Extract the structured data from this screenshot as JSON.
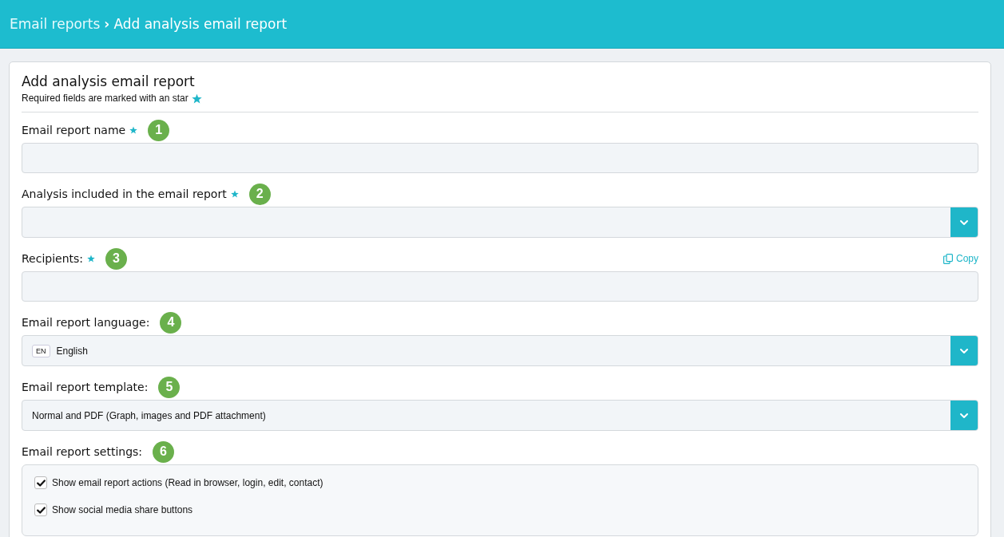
{
  "breadcrumb": {
    "parent": "Email reports",
    "separator": "›",
    "current": "Add analysis email report"
  },
  "form": {
    "title": "Add analysis email report",
    "subtitle": "Required fields are marked with an star",
    "fields": [
      {
        "kind": "text",
        "label": "Email report name",
        "required": true,
        "badge": "1"
      },
      {
        "kind": "select",
        "label": "Analysis included in the email report",
        "required": true,
        "badge": "2"
      },
      {
        "kind": "text",
        "label": "Recipients:",
        "required": true,
        "badge": "3",
        "action": "Copy"
      },
      {
        "kind": "select",
        "label": "Email report language:",
        "required": false,
        "badge": "4",
        "code": "EN",
        "value": "English"
      },
      {
        "kind": "select",
        "label": "Email report template:",
        "required": false,
        "badge": "5",
        "value": "Normal and PDF (Graph, images and PDF attachment)"
      },
      {
        "kind": "checklist",
        "label": "Email report settings:",
        "required": false,
        "badge": "6",
        "options": [
          {
            "label": "Show email report actions (Read in browser, login, edit, contact)",
            "checked": true
          },
          {
            "label": "Show social media share buttons",
            "checked": true
          }
        ]
      }
    ]
  }
}
